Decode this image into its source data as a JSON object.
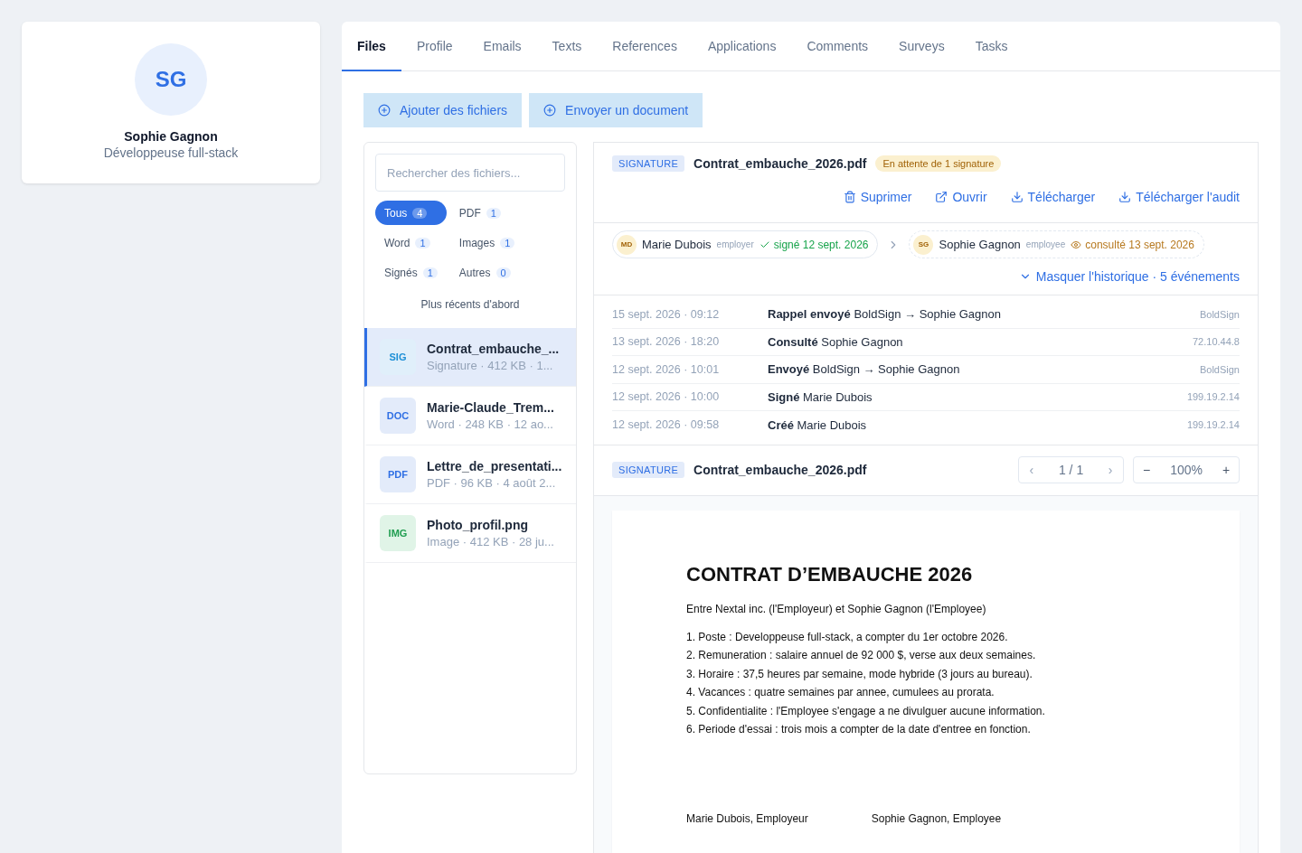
{
  "profile": {
    "initials": "SG",
    "name": "Sophie Gagnon",
    "role": "Développeuse full-stack"
  },
  "tabs": [
    {
      "label": "Files",
      "selected": true
    },
    {
      "label": "Profile",
      "selected": false
    },
    {
      "label": "Emails",
      "selected": false
    },
    {
      "label": "Texts",
      "selected": false
    },
    {
      "label": "References",
      "selected": false
    },
    {
      "label": "Applications",
      "selected": false
    },
    {
      "label": "Comments",
      "selected": false
    },
    {
      "label": "Surveys",
      "selected": false
    },
    {
      "label": "Tasks",
      "selected": false
    }
  ],
  "actions": [
    "Ajouter des fichiers",
    "Envoyer un document"
  ],
  "search": {
    "placeholder": "Rechercher des fichiers..."
  },
  "filters": [
    {
      "label": "Tous",
      "count": "4",
      "selected": true
    },
    {
      "label": "PDF",
      "count": "1",
      "selected": false
    },
    {
      "label": "Word",
      "count": "1",
      "selected": false
    },
    {
      "label": "Images",
      "count": "1",
      "selected": false
    },
    {
      "label": "Signés",
      "count": "1",
      "selected": false
    },
    {
      "label": "Autres",
      "count": "0",
      "selected": false
    }
  ],
  "sort": "Plus récents d'abord",
  "files": [
    {
      "kind": "sig",
      "badge": "SIG",
      "name": "Contrat_embauche_...",
      "meta": "Signature · 412 KB · 1...",
      "selected": true
    },
    {
      "kind": "doc",
      "badge": "DOC",
      "name": "Marie-Claude_Trem...",
      "meta": "Word · 248 KB · 12 ao...",
      "selected": false
    },
    {
      "kind": "pdf",
      "badge": "PDF",
      "name": "Lettre_de_presentati...",
      "meta": "PDF · 96 KB · 4 août 2...",
      "selected": false
    },
    {
      "kind": "img",
      "badge": "IMG",
      "name": "Photo_profil.png",
      "meta": "Image · 412 KB · 28 ju...",
      "selected": false
    }
  ],
  "detail": {
    "tag": "SIGNATURE",
    "filename": "Contrat_embauche_2026.pdf",
    "status": "En attente de 1 signature",
    "buttons": [
      {
        "kind": "delete",
        "label": "Suprimer"
      },
      {
        "kind": "open",
        "label": "Ouvrir"
      },
      {
        "kind": "download",
        "label": "Télécharger"
      },
      {
        "kind": "download",
        "label": "Télécharger l'audit"
      }
    ],
    "signers": [
      {
        "initials": "MD",
        "name": "Marie Dubois",
        "role": "employer",
        "kind": "signed",
        "status": "signé 12 sept. 2026"
      },
      {
        "initials": "SG",
        "name": "Sophie Gagnon",
        "role": "employee",
        "kind": "viewed",
        "status": "consulté 13 sept. 2026"
      }
    ],
    "history_toggle": "Masquer l'historique · 5 événements",
    "events": [
      {
        "time": "15 sept. 2026 · 09:12",
        "text": "**Rappel envoyé** BoldSign → Sophie Gagnon",
        "source": "BoldSign"
      },
      {
        "time": "13 sept. 2026 · 18:20",
        "text": "**Consulté** Sophie Gagnon",
        "source": "72.10.44.8"
      },
      {
        "time": "12 sept. 2026 · 10:01",
        "text": "**Envoyé** BoldSign → Sophie Gagnon",
        "source": "BoldSign"
      },
      {
        "time": "12 sept. 2026 · 10:00",
        "text": "**Signé** Marie Dubois",
        "source": "199.19.2.14"
      },
      {
        "time": "12 sept. 2026 · 09:58",
        "text": "**Créé** Marie Dubois",
        "source": "199.19.2.14"
      }
    ]
  },
  "viewer": {
    "tag": "SIGNATURE",
    "filename": "Contrat_embauche_2026.pdf",
    "prev": "‹",
    "page": "1 / 1",
    "next": "›",
    "zoom_out": "−",
    "zoom": "100%",
    "zoom_in": "+"
  },
  "document": {
    "title": "CONTRAT D’EMBAUCHE 2026",
    "intro": "Entre Nextal inc. (l'Employeur) et Sophie Gagnon (l'Employee)",
    "clauses": [
      "1. Poste : Developpeuse full-stack, a compter du 1er octobre 2026.",
      "2. Remuneration : salaire annuel de 92 000 $, verse aux deux semaines.",
      "3. Horaire : 37,5 heures par semaine, mode hybride (3 jours au bureau).",
      "4. Vacances : quatre semaines par annee, cumulees au prorata.",
      "5. Confidentialite : l'Employee s'engage a ne divulguer aucune information.",
      "6. Periode d'essai : trois mois a compter de la date d'entree en fonction."
    ],
    "signatures": [
      "Marie Dubois, Employeur",
      "Sophie Gagnon, Employee"
    ]
  }
}
